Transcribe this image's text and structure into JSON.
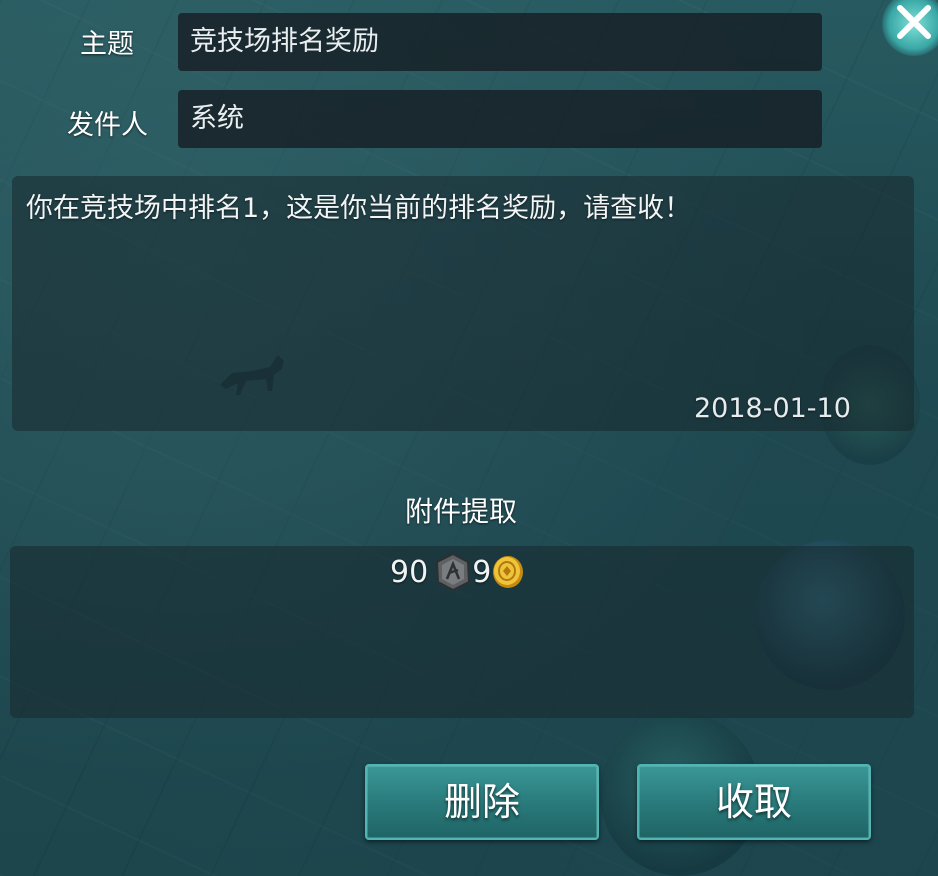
{
  "mail": {
    "subject_label": "主题",
    "subject_value": "竞技场排名奖励",
    "sender_label": "发件人",
    "sender_value": "系统",
    "body": "你在竞技场中排名1，这是你当前的排名奖励，请查收！",
    "date": "2018-01-10"
  },
  "attachment": {
    "title": "附件提取",
    "items": [
      {
        "amount": "90",
        "icon": "silver-coin-icon"
      },
      {
        "amount": "9",
        "icon": "gold-coin-icon"
      }
    ]
  },
  "buttons": {
    "delete": "删除",
    "collect": "收取"
  },
  "colors": {
    "button_teal": "#2a7b7c",
    "gold": "#e8b52a",
    "silver": "#6d6f72"
  }
}
